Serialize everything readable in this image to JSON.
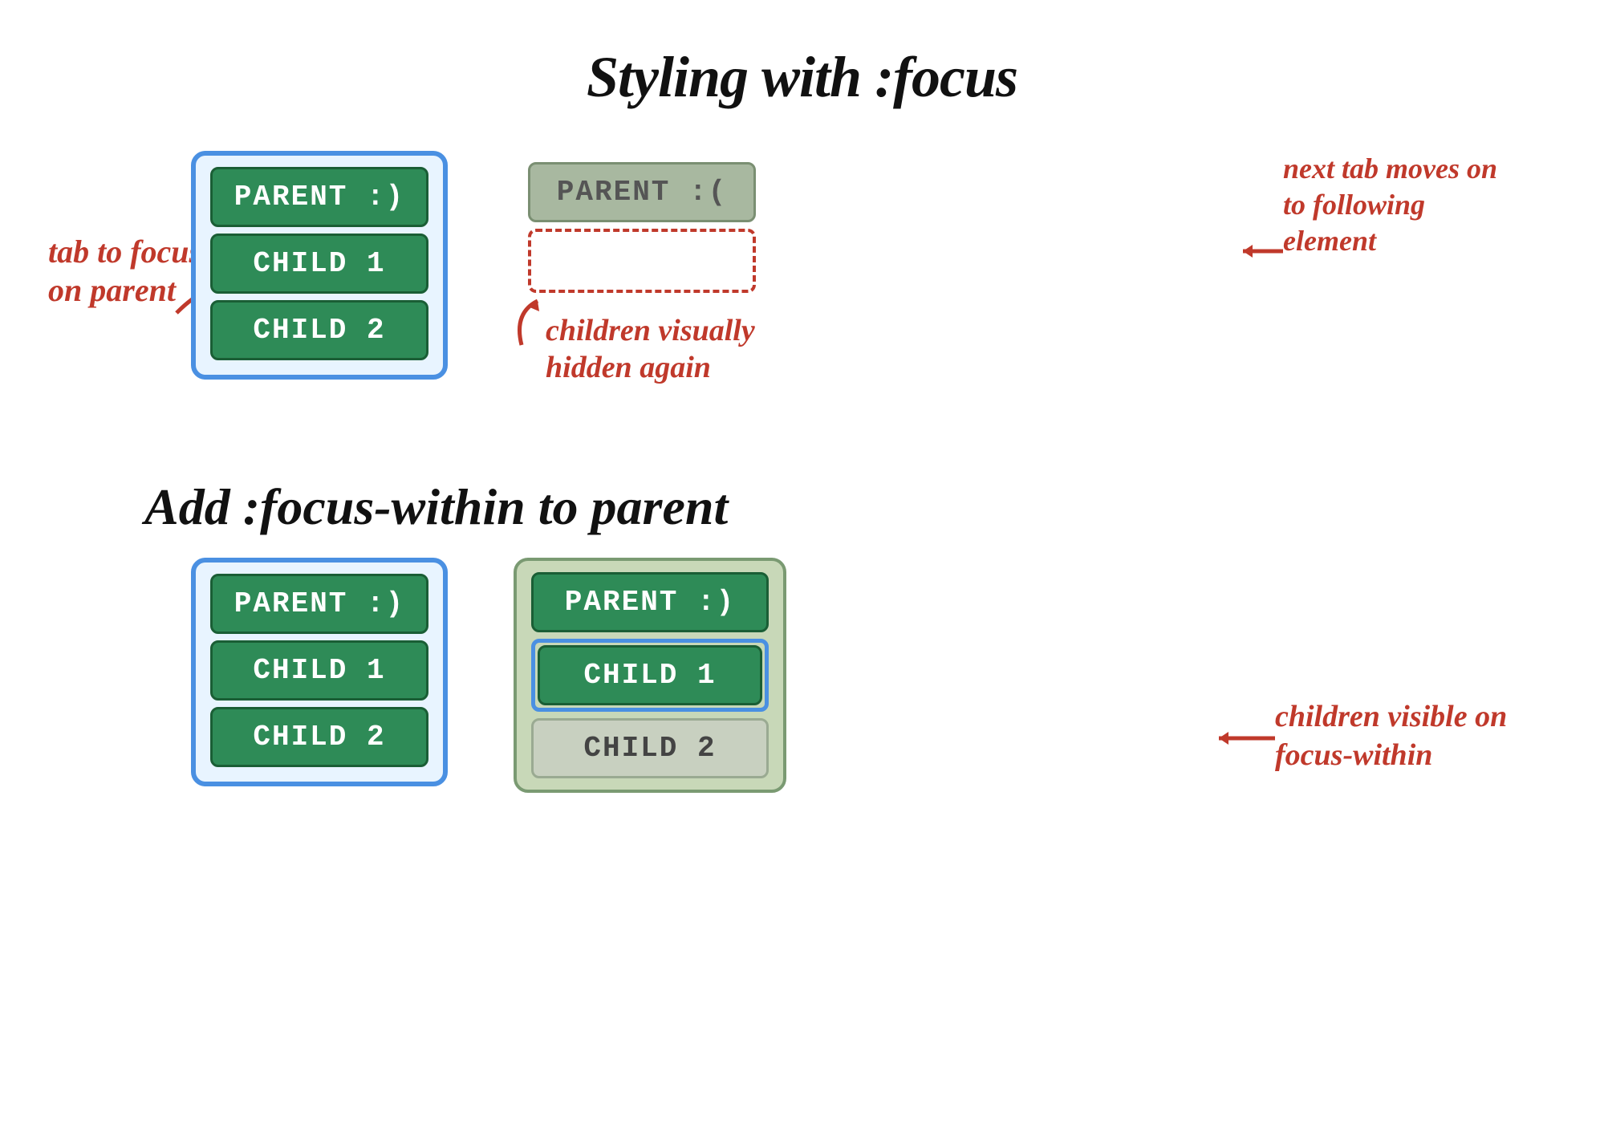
{
  "title": "Styling with :focus",
  "subtitle": "Add :focus-within to parent",
  "top_left": {
    "parent_label": "PARENT :)",
    "child1_label": "CHILD 1",
    "child2_label": "CHILD 2"
  },
  "top_right": {
    "parent_label": "PARENT :(",
    "note1": "next tab moves on to following element",
    "note2": "children visually hidden again"
  },
  "left_annotation": "tab to focus on parent",
  "bottom_left": {
    "parent_label": "PARENT :)",
    "child1_label": "CHILD 1",
    "child2_label": "CHILD 2"
  },
  "bottom_right": {
    "parent_label": "PARENT :)",
    "child1_label": "CHILD 1",
    "child2_label": "CHILD 2",
    "note": "children visible on focus-within"
  }
}
